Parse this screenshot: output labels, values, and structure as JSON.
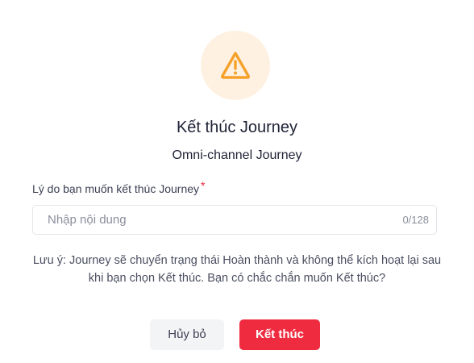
{
  "dialog": {
    "title": "Kết thúc Journey",
    "subtitle": "Omni-channel Journey",
    "field": {
      "label": "Lý do bạn muốn kết thúc Journey",
      "required_mark": "*",
      "placeholder": "Nhập nội dung",
      "value": "",
      "counter": "0/128"
    },
    "note": "Lưu ý: Journey sẽ chuyển trạng thái Hoàn thành và không thể kích hoạt lại sau khi bạn chọn Kết thúc. Bạn có chắc chắn muốn Kết thúc?",
    "buttons": {
      "cancel_label": "Hủy bỏ",
      "confirm_label": "Kết thúc"
    }
  },
  "icons": {
    "warning": "warning-triangle-icon"
  },
  "colors": {
    "warning_icon": "#f5a12a",
    "warning_bg": "#fef1e2",
    "confirm_bg": "#ef2b40",
    "required": "#e8283d"
  }
}
